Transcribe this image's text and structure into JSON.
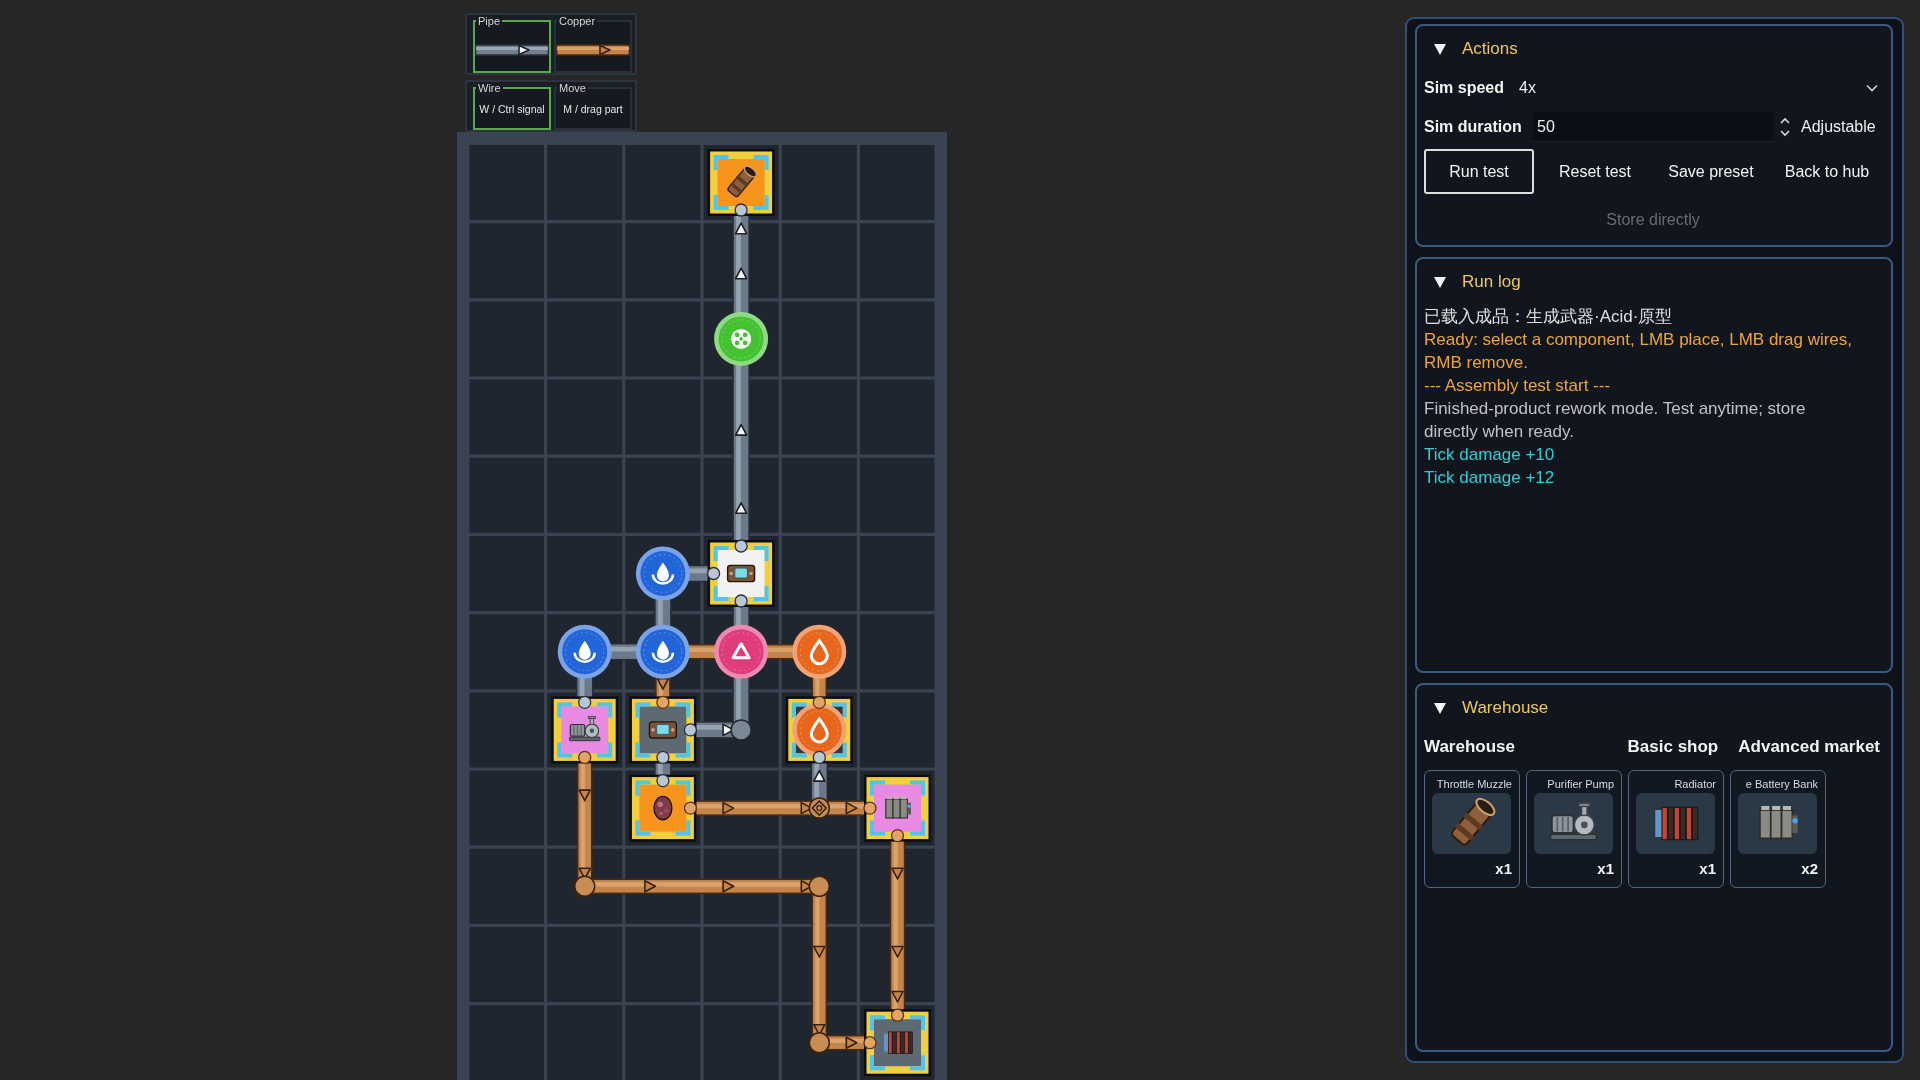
{
  "palette": [
    {
      "tools": [
        {
          "label": "Pipe",
          "kind": "pipe",
          "selected": true
        },
        {
          "label": "Copper",
          "kind": "copper",
          "selected": false
        }
      ]
    },
    {
      "tools": [
        {
          "label": "Wire",
          "kind": "shortcut",
          "hint": "W / Ctrl signal",
          "selected": true
        },
        {
          "label": "Move",
          "kind": "shortcut",
          "hint": "M / drag part",
          "selected": false
        }
      ]
    }
  ],
  "board": {
    "rows": [
      {
        "cells": [
          {
            "kind": "floor"
          },
          {
            "kind": "floor"
          },
          {
            "kind": "floor"
          },
          {
            "kind": "module",
            "module": {
              "kind": "muzzle",
              "color": "#f7941d"
            },
            "links": {
              "down": {
                "kind": "steel"
              }
            }
          },
          {
            "kind": "floor"
          },
          {
            "kind": "floor"
          }
        ]
      },
      {
        "cells": [
          {
            "kind": "floor"
          },
          {
            "kind": "floor"
          },
          {
            "kind": "floor"
          },
          {
            "kind": "floor",
            "links": {
              "up": {
                "kind": "steel"
              },
              "down": {
                "kind": "steel"
              }
            },
            "exit_arrows": [
              {
                "kind": "up"
              }
            ],
            "entry_arrows": [
              {
                "kind": "up"
              }
            ]
          },
          {
            "kind": "floor"
          },
          {
            "kind": "floor"
          }
        ]
      },
      {
        "cells": [
          {
            "kind": "floor"
          },
          {
            "kind": "floor"
          },
          {
            "kind": "floor"
          },
          {
            "kind": "node",
            "node": {
              "kind": "spore",
              "color": "#45c232"
            },
            "links": {
              "up": {
                "kind": "steel"
              },
              "down": {
                "kind": "steel"
              }
            }
          },
          {
            "kind": "floor"
          },
          {
            "kind": "floor"
          }
        ]
      },
      {
        "cells": [
          {
            "kind": "floor"
          },
          {
            "kind": "floor"
          },
          {
            "kind": "floor"
          },
          {
            "kind": "floor",
            "links": {
              "up": {
                "kind": "steel"
              },
              "down": {
                "kind": "steel"
              }
            },
            "entry_arrows": [
              {
                "kind": "up"
              }
            ]
          },
          {
            "kind": "floor"
          },
          {
            "kind": "floor"
          }
        ]
      },
      {
        "cells": [
          {
            "kind": "floor"
          },
          {
            "kind": "floor"
          },
          {
            "kind": "floor"
          },
          {
            "kind": "floor",
            "links": {
              "up": {
                "kind": "steel"
              },
              "down": {
                "kind": "steel"
              }
            },
            "entry_arrows": [
              {
                "kind": "up"
              }
            ]
          },
          {
            "kind": "floor"
          },
          {
            "kind": "floor"
          }
        ]
      },
      {
        "cells": [
          {
            "kind": "floor"
          },
          {
            "kind": "floor"
          },
          {
            "kind": "node",
            "node": {
              "kind": "drop",
              "color": "#2165d8"
            },
            "links": {
              "right": {
                "kind": "steel"
              },
              "down": {
                "kind": "steel"
              }
            }
          },
          {
            "kind": "module",
            "module": {
              "kind": "machine",
              "color": "#f2f2f2"
            },
            "links": {
              "up": {
                "kind": "steel"
              },
              "left": {
                "kind": "steel"
              },
              "down": {
                "kind": "steel"
              }
            }
          },
          {
            "kind": "floor"
          },
          {
            "kind": "floor"
          }
        ]
      },
      {
        "cells": [
          {
            "kind": "floor"
          },
          {
            "kind": "node",
            "node": {
              "kind": "drop",
              "color": "#2165d8"
            },
            "links": {
              "right": {
                "kind": "steel"
              },
              "down": {
                "kind": "steel"
              }
            }
          },
          {
            "kind": "node",
            "node": {
              "kind": "drop",
              "color": "#2165d8"
            },
            "links": {
              "up": {
                "kind": "steel"
              },
              "left": {
                "kind": "steel"
              },
              "right": {
                "kind": "copper"
              },
              "down": {
                "kind": "copper"
              }
            },
            "exit_arrows": [
              {
                "kind": "down"
              }
            ]
          },
          {
            "kind": "node",
            "node": {
              "kind": "triangle",
              "color": "#e03c7c"
            },
            "links": {
              "up": {
                "kind": "steel"
              },
              "left": {
                "kind": "copper"
              },
              "right": {
                "kind": "copper"
              },
              "down": {
                "kind": "steel"
              }
            }
          },
          {
            "kind": "node",
            "node": {
              "kind": "hollow-drop",
              "color": "#e8661b"
            },
            "links": {
              "left": {
                "kind": "copper"
              },
              "down": {
                "kind": "copper"
              }
            }
          },
          {
            "kind": "floor"
          }
        ]
      },
      {
        "cells": [
          {
            "kind": "floor"
          },
          {
            "kind": "module",
            "module": {
              "kind": "pump",
              "color": "#e98ae2"
            },
            "links": {
              "up": {
                "kind": "steel"
              },
              "down": {
                "kind": "copper"
              }
            }
          },
          {
            "kind": "module",
            "module": {
              "kind": "machine",
              "color": "#5d6a74"
            },
            "links": {
              "up": {
                "kind": "copper"
              },
              "right": {
                "kind": "steel"
              },
              "down": {
                "kind": "steel"
              }
            }
          },
          {
            "kind": "joint",
            "links": {
              "left": {
                "kind": "steel"
              },
              "up": {
                "kind": "steel"
              }
            },
            "entry_arrows": [
              {
                "kind": "right"
              }
            ]
          },
          {
            "kind": "module",
            "node": {
              "kind": "hollow-drop",
              "color": "#e8661b"
            },
            "links": {
              "up": {
                "kind": "copper"
              },
              "down": {
                "kind": "steel"
              }
            }
          },
          {
            "kind": "floor"
          }
        ]
      },
      {
        "cells": [
          {
            "kind": "floor"
          },
          {
            "kind": "floor",
            "links": {
              "up": {
                "kind": "copper"
              },
              "down": {
                "kind": "copper"
              }
            },
            "entry_arrows": [
              {
                "kind": "down"
              }
            ]
          },
          {
            "kind": "module",
            "module": {
              "kind": "orb",
              "color": "#f7941d"
            },
            "links": {
              "up": {
                "kind": "steel"
              },
              "right": {
                "kind": "copper"
              }
            }
          },
          {
            "kind": "floor",
            "links": {
              "left": {
                "kind": "copper"
              },
              "right": {
                "kind": "copper"
              }
            },
            "entry_arrows": [
              {
                "kind": "right"
              }
            ]
          },
          {
            "kind": "crossing",
            "links": {
              "left": {
                "kind": "copper"
              },
              "right": {
                "kind": "copper"
              },
              "up": {
                "kind": "steel"
              }
            },
            "entry_arrows": [
              {
                "kind": "right"
              }
            ],
            "exit_arrows": [
              {
                "kind": "right"
              },
              {
                "kind": "up"
              }
            ]
          },
          {
            "kind": "module",
            "module": {
              "kind": "battery",
              "color": "#e98ae2"
            },
            "links": {
              "left": {
                "kind": "copper"
              },
              "down": {
                "kind": "copper"
              }
            }
          }
        ]
      },
      {
        "cells": [
          {
            "kind": "floor"
          },
          {
            "kind": "joint",
            "links": {
              "up": {
                "kind": "copper"
              },
              "right": {
                "kind": "copper"
              }
            },
            "entry_arrows": [
              {
                "kind": "down"
              }
            ]
          },
          {
            "kind": "floor",
            "links": {
              "left": {
                "kind": "copper"
              },
              "right": {
                "kind": "copper"
              }
            },
            "entry_arrows": [
              {
                "kind": "right"
              }
            ]
          },
          {
            "kind": "floor",
            "links": {
              "left": {
                "kind": "copper"
              },
              "right": {
                "kind": "copper"
              }
            },
            "entry_arrows": [
              {
                "kind": "right"
              }
            ]
          },
          {
            "kind": "joint",
            "links": {
              "left": {
                "kind": "copper"
              },
              "down": {
                "kind": "copper"
              }
            },
            "entry_arrows": [
              {
                "kind": "right"
              }
            ]
          },
          {
            "kind": "floor",
            "links": {
              "up": {
                "kind": "copper"
              },
              "down": {
                "kind": "copper"
              }
            },
            "entry_arrows": [
              {
                "kind": "down"
              }
            ]
          }
        ]
      },
      {
        "cells": [
          {
            "kind": "floor"
          },
          {
            "kind": "floor"
          },
          {
            "kind": "floor"
          },
          {
            "kind": "floor"
          },
          {
            "kind": "floor",
            "links": {
              "up": {
                "kind": "copper"
              },
              "down": {
                "kind": "copper"
              }
            },
            "entry_arrows": [
              {
                "kind": "down"
              }
            ]
          },
          {
            "kind": "floor",
            "links": {
              "up": {
                "kind": "copper"
              },
              "down": {
                "kind": "copper"
              }
            },
            "entry_arrows": [
              {
                "kind": "down"
              }
            ],
            "exit_arrows": [
              {
                "kind": "down"
              }
            ]
          }
        ]
      },
      {
        "cells": [
          {
            "kind": "floor"
          },
          {
            "kind": "floor"
          },
          {
            "kind": "floor"
          },
          {
            "kind": "floor"
          },
          {
            "kind": "joint",
            "links": {
              "up": {
                "kind": "copper"
              },
              "right": {
                "kind": "copper"
              }
            },
            "entry_arrows": [
              {
                "kind": "down"
              }
            ],
            "exit_arrows": [
              {
                "kind": "right"
              }
            ]
          },
          {
            "kind": "module",
            "module": {
              "kind": "radiator",
              "color": "#5d6a74"
            },
            "links": {
              "up": {
                "kind": "copper"
              },
              "left": {
                "kind": "copper"
              }
            }
          }
        ]
      }
    ]
  },
  "actions": {
    "title": "Actions",
    "expanded": true,
    "sim_speed": {
      "label": "Sim speed",
      "value": "4x"
    },
    "sim_duration": {
      "label": "Sim duration",
      "value": "50",
      "note": "Adjustable"
    },
    "buttons": [
      {
        "label": "Run test",
        "focused": true
      },
      {
        "label": "Reset test",
        "focused": false
      },
      {
        "label": "Save preset",
        "focused": false
      },
      {
        "label": "Back to hub",
        "focused": false
      }
    ],
    "store_button": {
      "label": "Store directly",
      "disabled": true
    }
  },
  "run_log": {
    "title": "Run log",
    "expanded": true,
    "lines": [
      {
        "text": "已载入成品：生成武器·Acid·原型",
        "color": "#e0e0e0"
      },
      {
        "text": "Ready: select a component, LMB place, LMB drag wires, RMB remove.",
        "color": "#efa52f"
      },
      {
        "text": "--- Assembly test start ---",
        "color": "#efa52f"
      },
      {
        "text": "Finished-product rework mode. Test anytime; store directly when ready.",
        "color": "#c2c2c2"
      },
      {
        "text": "Tick damage +10",
        "color": "#2ecfd3"
      },
      {
        "text": "Tick damage +12",
        "color": "#2ecfd3"
      }
    ]
  },
  "warehouse": {
    "title": "Warehouse",
    "expanded": true,
    "bar": {
      "label": "Warehouse",
      "buttons": [
        "Basic shop",
        "Advanced market"
      ]
    },
    "items": [
      {
        "name": "Throttle Muzzle",
        "kind": "muzzle",
        "count": "x1"
      },
      {
        "name": "Purifier Pump",
        "kind": "pump",
        "count": "x1"
      },
      {
        "name": "Radiator",
        "kind": "radiator",
        "count": "x1"
      },
      {
        "name": "e Battery Bank",
        "kind": "battery",
        "count": "x2"
      }
    ]
  }
}
